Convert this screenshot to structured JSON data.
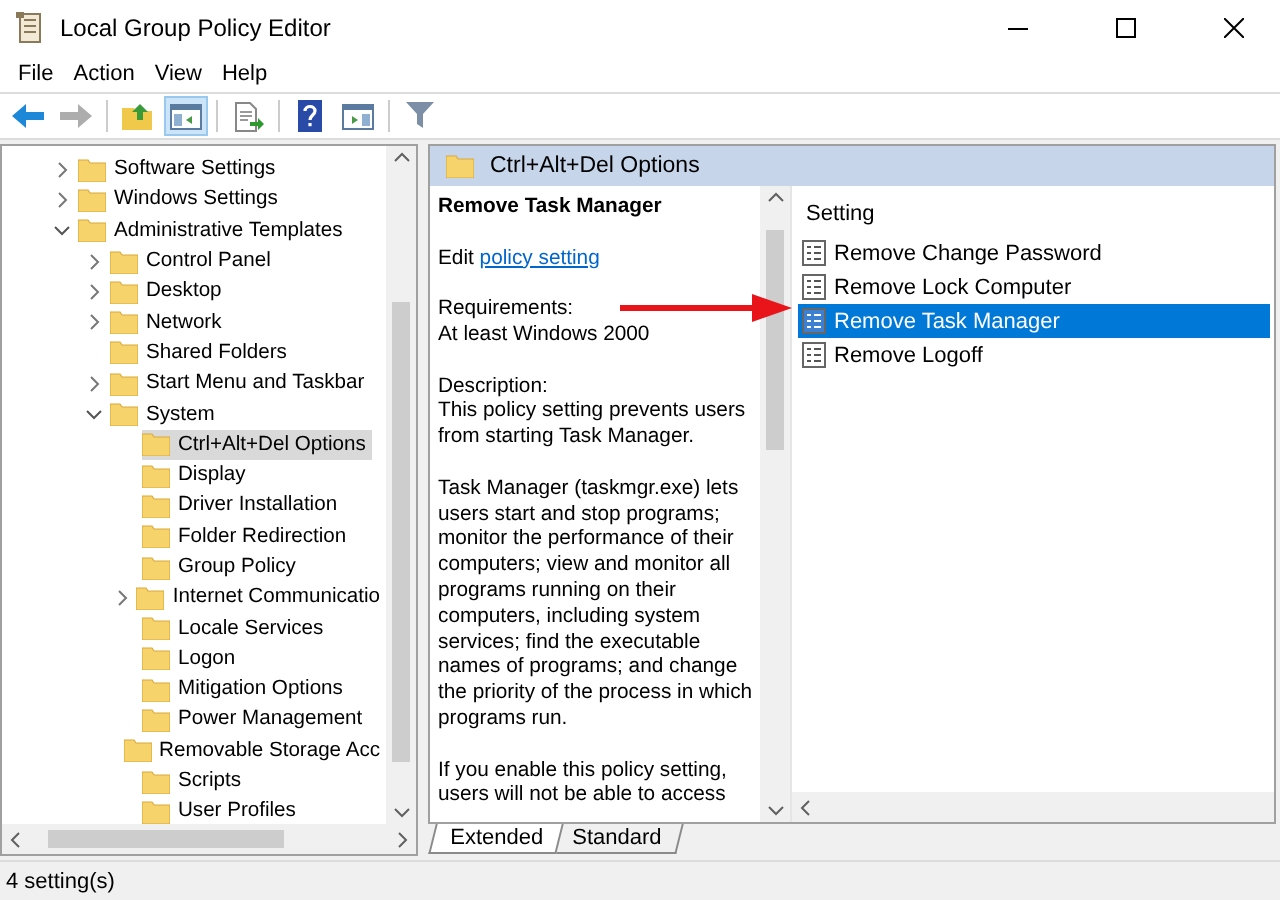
{
  "window": {
    "title": "Local Group Policy Editor"
  },
  "menu": [
    "File",
    "Action",
    "View",
    "Help"
  ],
  "toolbar": [
    {
      "kind": "back",
      "disabled": false,
      "pressed": false
    },
    {
      "kind": "forward",
      "disabled": true,
      "pressed": false
    },
    {
      "kind": "up",
      "disabled": false,
      "pressed": false
    },
    {
      "kind": "tree",
      "disabled": false,
      "pressed": true
    },
    {
      "kind": "export",
      "disabled": false,
      "pressed": false
    },
    {
      "kind": "help",
      "disabled": false,
      "pressed": false
    },
    {
      "kind": "pane",
      "disabled": false,
      "pressed": false
    },
    {
      "kind": "filter",
      "disabled": false,
      "pressed": false
    }
  ],
  "tree": [
    {
      "label": "Software Settings",
      "selected": false,
      "expanded": false
    },
    {
      "label": "Windows Settings",
      "selected": false,
      "expanded": false
    },
    {
      "label": "Administrative Templates",
      "selected": false,
      "expanded": true,
      "children": [
        {
          "label": "Control Panel",
          "selected": false,
          "expanded": false
        },
        {
          "label": "Desktop",
          "selected": false,
          "expanded": false
        },
        {
          "label": "Network",
          "selected": false,
          "expanded": false
        },
        {
          "label": "Shared Folders",
          "selected": false
        },
        {
          "label": "Start Menu and Taskbar",
          "selected": false,
          "expanded": false
        },
        {
          "label": "System",
          "selected": false,
          "expanded": true,
          "children": [
            {
              "label": "Ctrl+Alt+Del Options",
              "selected": true
            },
            {
              "label": "Display",
              "selected": false
            },
            {
              "label": "Driver Installation",
              "selected": false
            },
            {
              "label": "Folder Redirection",
              "selected": false
            },
            {
              "label": "Group Policy",
              "selected": false
            },
            {
              "label": "Internet Communicatio",
              "selected": false,
              "expanded": false
            },
            {
              "label": "Locale Services",
              "selected": false
            },
            {
              "label": "Logon",
              "selected": false
            },
            {
              "label": "Mitigation Options",
              "selected": false
            },
            {
              "label": "Power Management",
              "selected": false
            },
            {
              "label": "Removable Storage Acc",
              "selected": false
            },
            {
              "label": "Scripts",
              "selected": false
            },
            {
              "label": "User Profiles",
              "selected": false
            }
          ]
        }
      ]
    }
  ],
  "pane_header": "Ctrl+Alt+Del Options",
  "description": {
    "title": "Remove Task Manager",
    "edit_prefix": "Edit",
    "edit_link": "policy setting",
    "requirements_label": "Requirements:",
    "requirements": "At least Windows 2000",
    "description_label": "Description:",
    "paragraphs": [
      "This policy setting prevents users from starting Task Manager.",
      "Task Manager (taskmgr.exe) lets users start and stop programs; monitor the performance of their computers; view and monitor all programs running on their computers, including system services; find the executable names of programs; and change the priority of the process in which programs run.",
      "If you enable this policy setting, users will not be able to access"
    ]
  },
  "list": {
    "column": "Setting",
    "rows": [
      {
        "label": "Remove Change Password",
        "selected": false
      },
      {
        "label": "Remove Lock Computer",
        "selected": false
      },
      {
        "label": "Remove Task Manager",
        "selected": true
      },
      {
        "label": "Remove Logoff",
        "selected": false
      }
    ]
  },
  "tabs": [
    {
      "label": "Extended",
      "selected": true
    },
    {
      "label": "Standard",
      "selected": false
    }
  ],
  "status_bar": "4 setting(s)"
}
